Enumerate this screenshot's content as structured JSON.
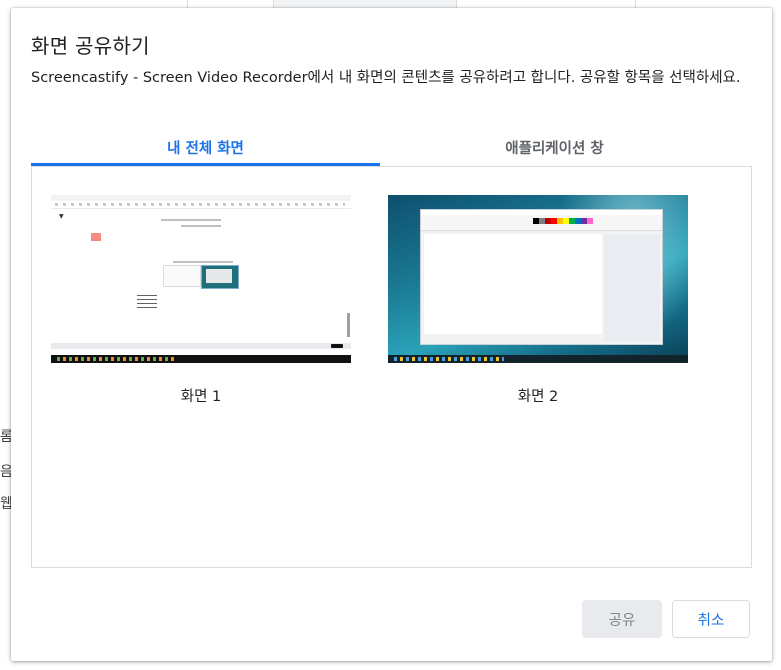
{
  "background": {
    "side_chars": [
      "롬",
      "음",
      "웹"
    ]
  },
  "dialog": {
    "title": "화면 공유하기",
    "description": "Screencastify - Screen Video Recorder에서 내 화면의 콘텐츠를 공유하려고 합니다. 공유할 항목을 선택하세요.",
    "tabs": [
      {
        "label": "내 전체 화면",
        "active": true
      },
      {
        "label": "애플리케이션 창",
        "active": false
      }
    ],
    "sources": [
      {
        "label": "화면 1"
      },
      {
        "label": "화면 2"
      }
    ],
    "buttons": {
      "share": "공유",
      "cancel": "취소"
    }
  },
  "colors": {
    "accent": "#1a73e8",
    "disabled_bg": "#e8eaed",
    "disabled_text": "#80868b"
  }
}
